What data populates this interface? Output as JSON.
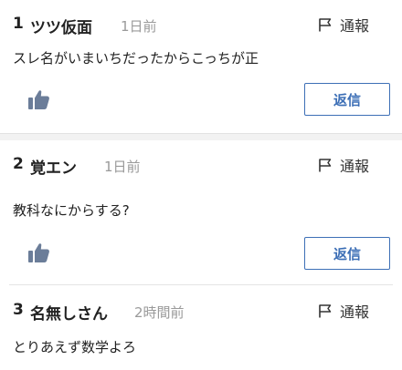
{
  "posts": [
    {
      "number": "1",
      "author": "ツツ仮面",
      "time": "1日前",
      "report_label": "通報",
      "body": "スレ名がいまいちだったからこっちが正",
      "reply_label": "返信"
    },
    {
      "number": "2",
      "author": "覚エン",
      "time": "1日前",
      "report_label": "通報",
      "body": "教科なにからする?",
      "reply_label": "返信"
    },
    {
      "number": "3",
      "author": "名無しさん",
      "time": "2時間前",
      "report_label": "通報",
      "body": "とりあえず数学よろ"
    }
  ],
  "icons": {
    "report": "flag-icon",
    "like": "thumbs-up-icon"
  },
  "colors": {
    "accent": "#3d6fb6",
    "muted_text": "#9a9a9a",
    "like_icon": "#6b7d99"
  }
}
